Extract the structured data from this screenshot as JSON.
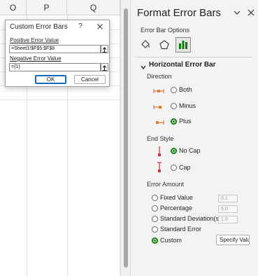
{
  "sheet": {
    "columns": [
      "O",
      "P",
      "Q"
    ]
  },
  "dialog": {
    "title": "Custom Error Bars",
    "help_label": "?",
    "positive_label": "Positive Error Value",
    "positive_value": "=Sheet1!$F$5:$F$8",
    "negative_label": "Negative Error Value",
    "negative_value": "={1}",
    "ok_label": "OK",
    "cancel_label": "Cancel"
  },
  "pane": {
    "title": "Format Error Bars",
    "section_label": "Error Bar Options",
    "tabs": [
      {
        "icon": "paint-bucket-icon",
        "selected": false
      },
      {
        "icon": "pentagon-icon",
        "selected": false
      },
      {
        "icon": "bar-chart-icon",
        "selected": true
      }
    ],
    "group_header": "Horizontal Error Bar",
    "direction": {
      "label": "Direction",
      "options": [
        {
          "label": "Both",
          "checked": false
        },
        {
          "label": "Minus",
          "checked": false
        },
        {
          "label": "Plus",
          "checked": true
        }
      ]
    },
    "end_style": {
      "label": "End Style",
      "options": [
        {
          "label": "No Cap",
          "checked": true
        },
        {
          "label": "Cap",
          "checked": false
        }
      ]
    },
    "error_amount": {
      "label": "Error Amount",
      "options": [
        {
          "label": "Fixed Value",
          "checked": false,
          "value": "0.1"
        },
        {
          "label": "Percentage",
          "checked": false,
          "value": "5.0"
        },
        {
          "label": "Standard Deviation(s)",
          "checked": false,
          "value": "1.0"
        },
        {
          "label": "Standard Error",
          "checked": false
        },
        {
          "label": "Custom",
          "checked": true
        }
      ],
      "specify_label": "Specify Value"
    }
  },
  "colors": {
    "accent_green": "#107c10",
    "icon_orange": "#e07b39",
    "icon_red": "#d13438"
  }
}
